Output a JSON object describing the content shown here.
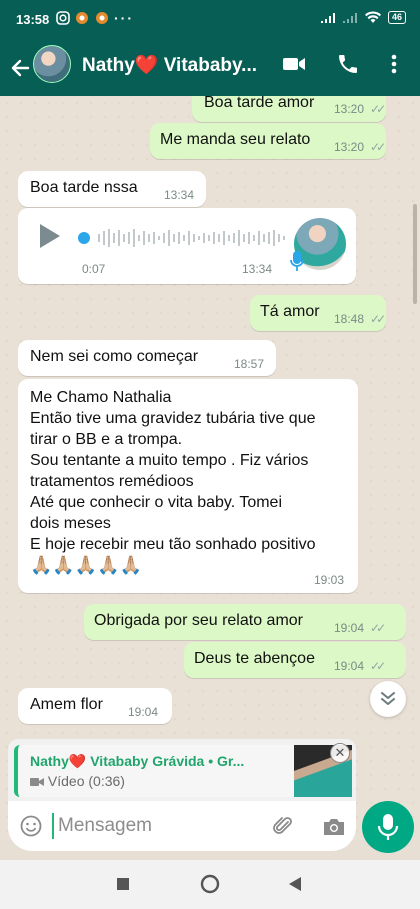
{
  "status_bar": {
    "time": "13:58",
    "battery": "46"
  },
  "header": {
    "title": "Nathy❤️ Vitababy..."
  },
  "messages": [
    {
      "dir": "out",
      "text": "Boa tarde amor",
      "time": "13:20",
      "ticks": "✓✓"
    },
    {
      "dir": "out",
      "text": "Me manda seu relato",
      "time": "13:20",
      "ticks": "✓✓"
    },
    {
      "dir": "in",
      "text": "Boa tarde nssa",
      "time": "13:34"
    },
    {
      "dir": "in",
      "type": "voice",
      "elapsed": "0:07",
      "time": "13:34"
    },
    {
      "dir": "out",
      "text": "Tá amor",
      "time": "18:48",
      "ticks": "✓✓"
    },
    {
      "dir": "in",
      "text": "Nem sei como começar",
      "time": "18:57"
    },
    {
      "dir": "in",
      "lines": [
        "Me Chamo Nathalia",
        "Então tive uma gravidez tubária tive que",
        "tirar o BB e a trompa.",
        "Sou tentante a muito tempo . Fiz vários",
        "tratamentos remédioos",
        "Até que conhecir o vita baby. Tomei",
        "dois meses",
        "E hoje recebir meu tão sonhado positivo",
        "🙏🏼🙏🏼🙏🏼🙏🏼🙏🏼"
      ],
      "time": "19:03"
    },
    {
      "dir": "out",
      "text": "Obrigada por seu relato amor",
      "time": "19:04",
      "ticks": "✓✓"
    },
    {
      "dir": "out",
      "text": "Deus te abençoe",
      "time": "19:04",
      "ticks": "✓✓"
    },
    {
      "dir": "in",
      "text": "Amem flor",
      "time": "19:04"
    }
  ],
  "reply_preview": {
    "name": "Nathy❤️ Vitababy Grávida • Gr...",
    "subtitle": "Vídeo (0:36)"
  },
  "composer": {
    "placeholder": "Mensagem"
  },
  "colors": {
    "header": "#075e54",
    "outgoing": "#dcf8c6",
    "accent": "#00a884"
  }
}
